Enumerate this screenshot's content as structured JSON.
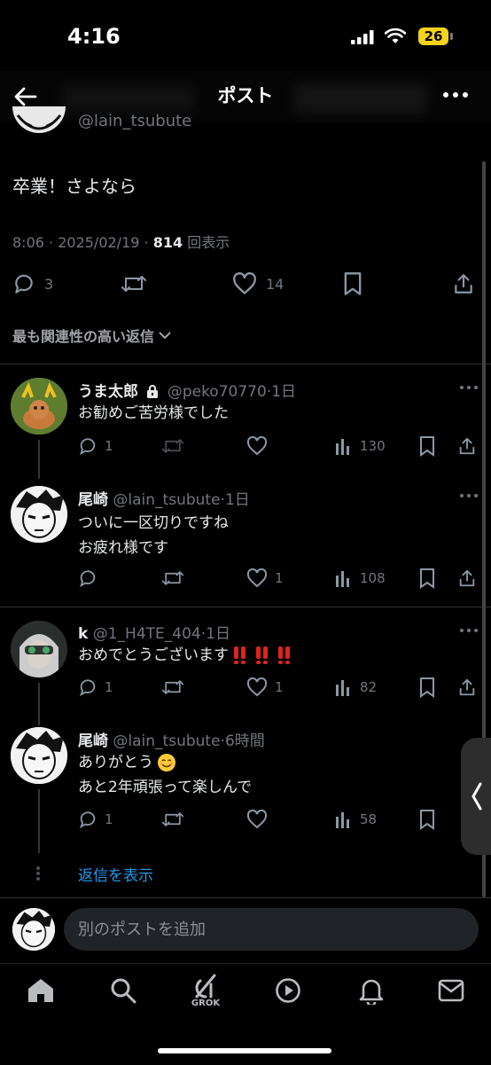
{
  "status_bar": {
    "time": "4:16",
    "battery": "26"
  },
  "header": {
    "title": "ポスト"
  },
  "main_post": {
    "handle": "@lain_tsubute",
    "text": "卒業！さよなら",
    "time": "8:06",
    "date": "2025/02/19",
    "views": "814",
    "views_label": "回表示",
    "replies": "3",
    "likes": "14"
  },
  "sort": {
    "label": "最も関連性の高い返信"
  },
  "replies": [
    {
      "name": "うま太郎",
      "handle": "@peko70770",
      "age": "1日",
      "text": "お勧めご苦労様でした",
      "reply_count": "1",
      "retweet_count": "",
      "like_count": "",
      "views": "130"
    },
    {
      "name": "尾崎",
      "handle": "@lain_tsubute",
      "age": "1日",
      "text_lines": [
        "ついに一区切りですね",
        "お疲れ様です"
      ],
      "reply_count": "",
      "retweet_count": "",
      "like_count": "1",
      "views": "108"
    },
    {
      "name": "k",
      "handle": "@1_H4TE_404",
      "age": "1日",
      "text": "おめでとうございます",
      "reply_count": "1",
      "retweet_count": "",
      "like_count": "1",
      "views": "82"
    },
    {
      "name": "尾崎",
      "handle": "@lain_tsubute",
      "age": "6時間",
      "text_lines": [
        "ありがとう",
        "あと2年頑張って楽しんで"
      ],
      "reply_count": "1",
      "retweet_count": "",
      "like_count": "",
      "views": "58"
    }
  ],
  "show_replies": "返信を表示",
  "compose": {
    "placeholder": "別のポストを追加"
  },
  "nav": {
    "grok_label": "GROK"
  },
  "colors": {
    "background": "#000000",
    "text": "#e7e9ea",
    "muted": "#71767b",
    "link": "#1d9bf0",
    "divider": "#2f3336",
    "battery": "#f5d21b"
  },
  "icons": [
    "back-arrow-icon",
    "more-icon",
    "reply-icon",
    "retweet-icon",
    "like-icon",
    "views-icon",
    "bookmark-icon",
    "share-icon",
    "home-icon",
    "search-icon",
    "grok-icon",
    "video-icon",
    "bell-icon",
    "mail-icon",
    "lock-icon"
  ]
}
